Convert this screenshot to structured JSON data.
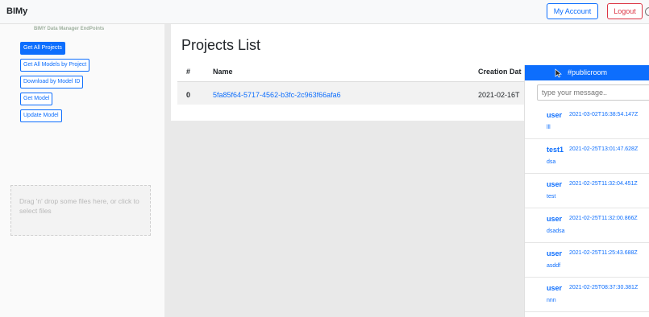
{
  "navbar": {
    "brand": "BIMy",
    "account_label": "My Account",
    "logout_label": "Logout"
  },
  "sidebar": {
    "title": "BIMY Data Manager EndPoints",
    "buttons": [
      {
        "label": "Get All Projects",
        "active": true
      },
      {
        "label": "Get All Models by Project",
        "active": false
      },
      {
        "label": "Download by Model ID",
        "active": false
      },
      {
        "label": "Get Model",
        "active": false
      },
      {
        "label": "Update Model",
        "active": false
      }
    ],
    "dropzone_text": "Drag 'n' drop some files here, or click to select files"
  },
  "main": {
    "title": "Projects List",
    "columns": [
      "#",
      "Name",
      "Creation Dat"
    ],
    "rows": [
      {
        "index": "0",
        "name": "5fa85f64-5717-4562-b3fc-2c963f66afa6",
        "date": "2021-02-16T"
      }
    ]
  },
  "chat": {
    "room": "#publicroom",
    "input_placeholder": "type your message..",
    "messages": [
      {
        "user": "user",
        "time": "2021-03-02T16:38:54.147Z",
        "text": "lll"
      },
      {
        "user": "test1",
        "time": "2021-02-25T13:01:47.628Z",
        "text": "dsa"
      },
      {
        "user": "user",
        "time": "2021-02-25T11:32:04.451Z",
        "text": "test"
      },
      {
        "user": "user",
        "time": "2021-02-25T11:32:00.866Z",
        "text": "dsadsa"
      },
      {
        "user": "user",
        "time": "2021-02-25T11:25:43.688Z",
        "text": "asddf"
      },
      {
        "user": "user",
        "time": "2021-02-25T08:37:30.381Z",
        "text": "nnn"
      }
    ]
  },
  "colors": {
    "primary": "#0d6efd",
    "danger": "#dc3545",
    "navbar_bg": "#f8f9fa",
    "page_bg": "#e9e9e9"
  }
}
